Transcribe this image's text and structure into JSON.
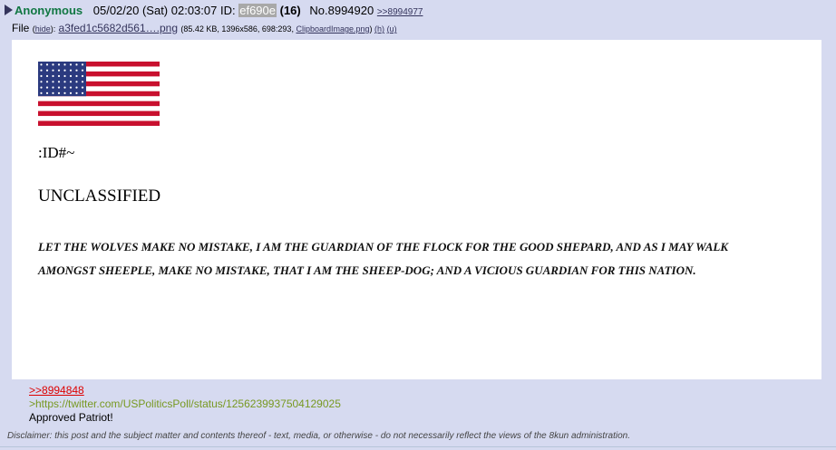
{
  "post": {
    "name": "Anonymous",
    "datetime": "05/02/20 (Sat) 02:03:07",
    "id_label": "ID:",
    "id_value": "ef690e",
    "id_count": "(16)",
    "number": "No.8994920",
    "backlink": ">>8994977"
  },
  "file": {
    "label": "File",
    "hide_open": "(",
    "hide_label": "hide",
    "hide_close": "):",
    "filename": "a3fed1c5682d561….png",
    "meta": "(85.42 KB, 1396x586, 698:293,",
    "original_name": "ClipboardImage.png",
    "meta_close": ")",
    "h_label": "(h)",
    "u_label": "(u)"
  },
  "image": {
    "id_text": ":ID#~",
    "classification": "UNCLASSIFIED",
    "statement": "LET THE WOLVES MAKE NO MISTAKE, I AM THE GUARDIAN OF THE FLOCK FOR THE GOOD SHEPARD, AND AS I MAY WALK AMONGST SHEEPLE, MAKE NO MISTAKE, THAT I AM THE SHEEP-DOG; AND A VICIOUS GUARDIAN FOR THIS NATION."
  },
  "body": {
    "quote": ">>8994848",
    "green": ">https://twitter.com/USPoliticsPoll/status/1256239937504129025",
    "text": "Approved Patriot!"
  },
  "disclaimer": "Disclaimer: this post and the subject matter and contents thereof - text, media, or otherwise - do not necessarily reflect the views of the 8kun administration.",
  "colors": {
    "background": "#d6daf0",
    "name": "#117743",
    "link": "#34345c",
    "quotelink": "#dd0000",
    "greentext": "#789922"
  }
}
